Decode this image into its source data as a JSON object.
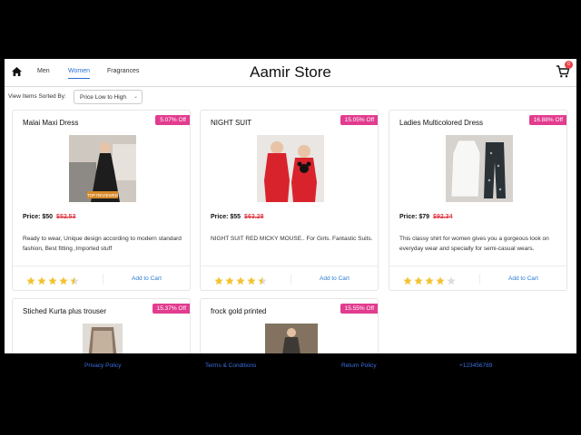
{
  "navbar": {
    "links": [
      {
        "label": "Men"
      },
      {
        "label": "Women"
      },
      {
        "label": "Fragrances"
      }
    ],
    "brand": "Aamir Store",
    "cart_count": "0"
  },
  "sort": {
    "label": "View Items Sorted By:",
    "selected": "Price Low to High"
  },
  "products": [
    {
      "title": "Malai Maxi Dress",
      "discount": "5.07% Off",
      "price_label": "Price: $50",
      "old_price": "$52.53",
      "description": "Ready to wear, Unique design according to modern standard fashion, Best fitting ,Imported stuff",
      "rating": 4.5,
      "add_to_cart": "Add to Cart",
      "image_badge": "TOP REVIEWED"
    },
    {
      "title": "NIGHT SUIT",
      "discount": "15.05% Off",
      "price_label": "Price: $55",
      "old_price": "$63.28",
      "description": "NIGHT SUIT RED MICKY MOUSE.. For Girls. Fantastic Suits.",
      "rating": 4.5,
      "add_to_cart": "Add to Cart"
    },
    {
      "title": "Ladies Multicolored Dress",
      "discount": "16.88% Off",
      "price_label": "Price: $79",
      "old_price": "$92.34",
      "description": "This classy shirt for women gives you a gorgeous look on everyday wear and specially for semi-casual wears.",
      "rating": 4,
      "add_to_cart": "Add to Cart"
    },
    {
      "title": "Stiched Kurta plus trouser",
      "discount": "15.37% Off"
    },
    {
      "title": "frock gold printed",
      "discount": "15.55% Off"
    }
  ],
  "footer": {
    "links": [
      "Privacy Policy",
      "Terms & Conditions",
      "Return Policy",
      "+123456789"
    ]
  },
  "colors": {
    "accent": "#2a6fd6",
    "discount": "#e23c8f",
    "star": "#f2c230",
    "star_empty": "#dddddd",
    "old_price": "#e0404a",
    "badge": "#e8424a"
  }
}
